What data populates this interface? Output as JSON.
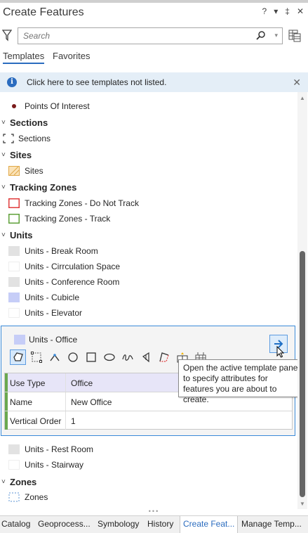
{
  "pane": {
    "title": "Create Features",
    "controls": [
      "?",
      "▾",
      "‡",
      "✕"
    ]
  },
  "search": {
    "placeholder": "Search"
  },
  "tabs": [
    {
      "label": "Templates",
      "active": true
    },
    {
      "label": "Favorites",
      "active": false
    }
  ],
  "info_bar": {
    "message": "Click here to see templates not listed."
  },
  "templates": {
    "points_of_interest": "Points Of Interest",
    "sections_group": "Sections",
    "sections_item": "Sections",
    "sites_group": "Sites",
    "sites_item": "Sites",
    "tracking_group": "Tracking Zones",
    "tracking_do_not_track": "Tracking Zones - Do Not Track",
    "tracking_track": "Tracking Zones - Track",
    "units_group": "Units",
    "units_break_room": "Units - Break Room",
    "units_circulation": "Units - Cirrculation Space",
    "units_conference": "Units - Conference Room",
    "units_cubicle": "Units - Cubicle",
    "units_elevator": "Units - Elevator",
    "units_office": "Units - Office",
    "units_rest_room": "Units - Rest Room",
    "units_stairway": "Units - Stairway",
    "zones_group": "Zones",
    "zones_item": "Zones"
  },
  "attributes": [
    {
      "key": "Use Type",
      "value": "Office"
    },
    {
      "key": "Name",
      "value": "New Office"
    },
    {
      "key": "Vertical Order",
      "value": "1"
    }
  ],
  "tooltip": "Open the active template pane to specify attributes for features you are about to create.",
  "bottom_tabs": [
    "Catalog",
    "Geoprocess...",
    "Symbology",
    "History",
    "Create Feat...",
    "Manage Temp..."
  ],
  "colors": {
    "accent": "#2b6cbf",
    "selection_border": "#3a8ad8",
    "point_symbol": "#7a1b1b",
    "sites_fill": "#f2c57c",
    "do_not_track": "#e03c3c",
    "track": "#5fa13a",
    "cubicle_fill": "#c6cdf7",
    "break_room_fill": "#e2e2e2"
  }
}
